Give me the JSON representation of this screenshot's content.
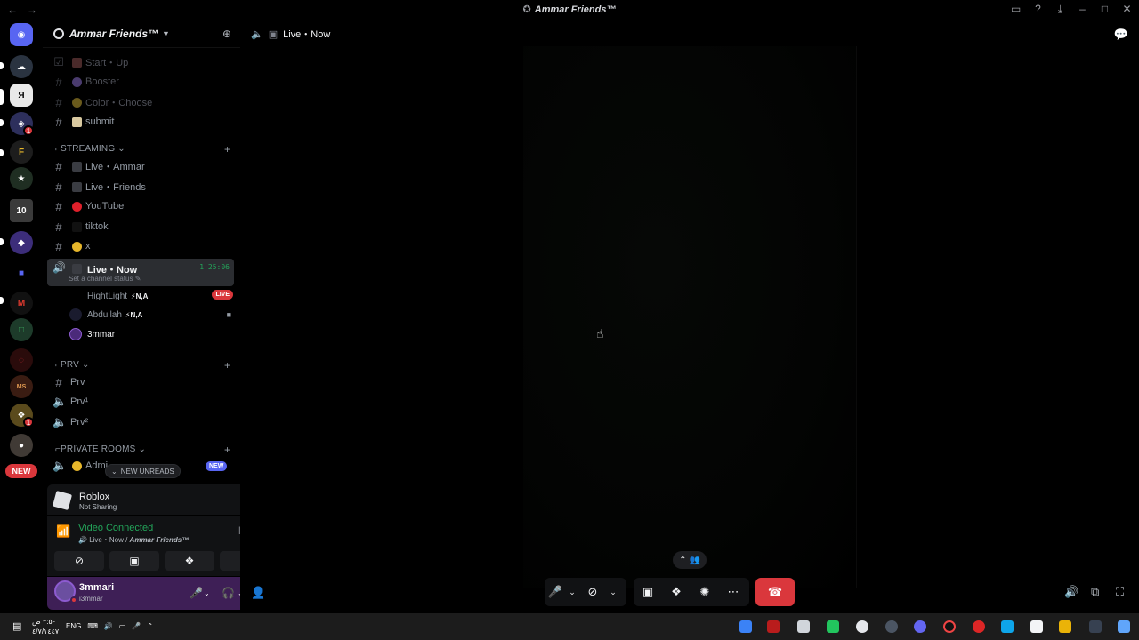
{
  "window": {
    "title": "Ammar Friends™",
    "nav_back": "←",
    "nav_forward": "→"
  },
  "guild": {
    "name": "Ammar Friends™"
  },
  "channels_top": [
    {
      "label": "Start・Up",
      "muted": true
    },
    {
      "label": "Booster",
      "muted": true
    },
    {
      "label": "Color・Choose",
      "muted": true
    },
    {
      "label": "submit",
      "muted": false
    }
  ],
  "categories": {
    "streaming": "STREAMING",
    "prv": "PRV",
    "private_rooms": "PRIVATE ROOMS"
  },
  "streaming_channels": [
    {
      "label": "Live・Ammar"
    },
    {
      "label": "Live・Friends"
    },
    {
      "label": "YouTube"
    },
    {
      "label": "tiktok"
    },
    {
      "label": "x"
    }
  ],
  "active_voice": {
    "name": "Live・Now",
    "time": "1:25:06",
    "status": "Set a channel status"
  },
  "voice_users": [
    {
      "name": "HightLight",
      "tag": "⚡N,A",
      "live": "LIVE"
    },
    {
      "name": "Abdullah",
      "tag": "⚡N,A"
    },
    {
      "name": "3mmar",
      "tag": ""
    }
  ],
  "prv_channels": [
    {
      "label": "Prv"
    },
    {
      "label": "Prv¹"
    },
    {
      "label": "Prv²"
    }
  ],
  "private_rooms": {
    "first": "Admi",
    "new_badge": "NEW",
    "new_unreads": "NEW UNREADS"
  },
  "activity": {
    "game": "Roblox",
    "status": "Not Sharing"
  },
  "voice_connection": {
    "state": "Video Connected",
    "location": "Live・Now / ",
    "server": "Ammar Friends™"
  },
  "user": {
    "display_name": "3mmari",
    "handle": "i3mmar"
  },
  "main": {
    "channel_title": "Live・Now"
  },
  "rail": {
    "new_pill": "NEW",
    "badges": [
      "1",
      "1"
    ]
  },
  "taskbar": {
    "time": "٣:٥٠ ص",
    "date": "٤/٧/١٤٤٧",
    "lang": "ENG"
  },
  "colors": {
    "accent_green": "#23a55a",
    "danger_red": "#da373c",
    "blurple": "#5865f2"
  }
}
